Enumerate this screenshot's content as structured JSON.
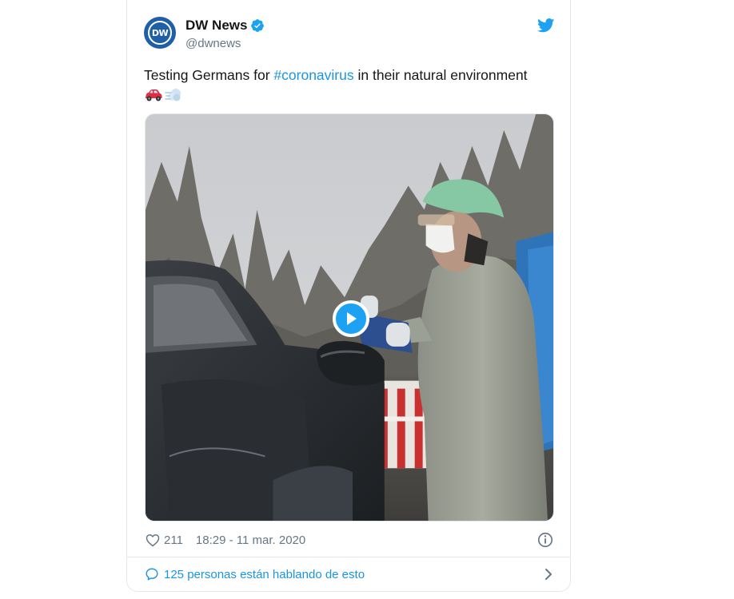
{
  "tweet": {
    "display_name": "DW News",
    "handle": "@dwnews",
    "avatar_text": "DW",
    "text_before": "Testing Germans for ",
    "hashtag": "#coronavirus",
    "text_after": " in their natural environment",
    "emojis": [
      "car-emoji",
      "dash-emoji"
    ],
    "likes": "211",
    "timestamp": "18:29 - 11 mar. 2020",
    "conversation": "125 personas están hablando de esto"
  },
  "icons": {
    "verified": "verified-badge-icon",
    "brand": "twitter-bird-icon",
    "like": "heart-icon",
    "info": "info-icon",
    "reply": "speech-bubble-icon",
    "chevron": "chevron-right-icon",
    "play": "play-icon"
  },
  "colors": {
    "accent": "#1da1f2",
    "link": "#1b95e0",
    "muted": "#657786",
    "border": "#e1e8ed",
    "brand_dw": "#1f5fa6"
  }
}
